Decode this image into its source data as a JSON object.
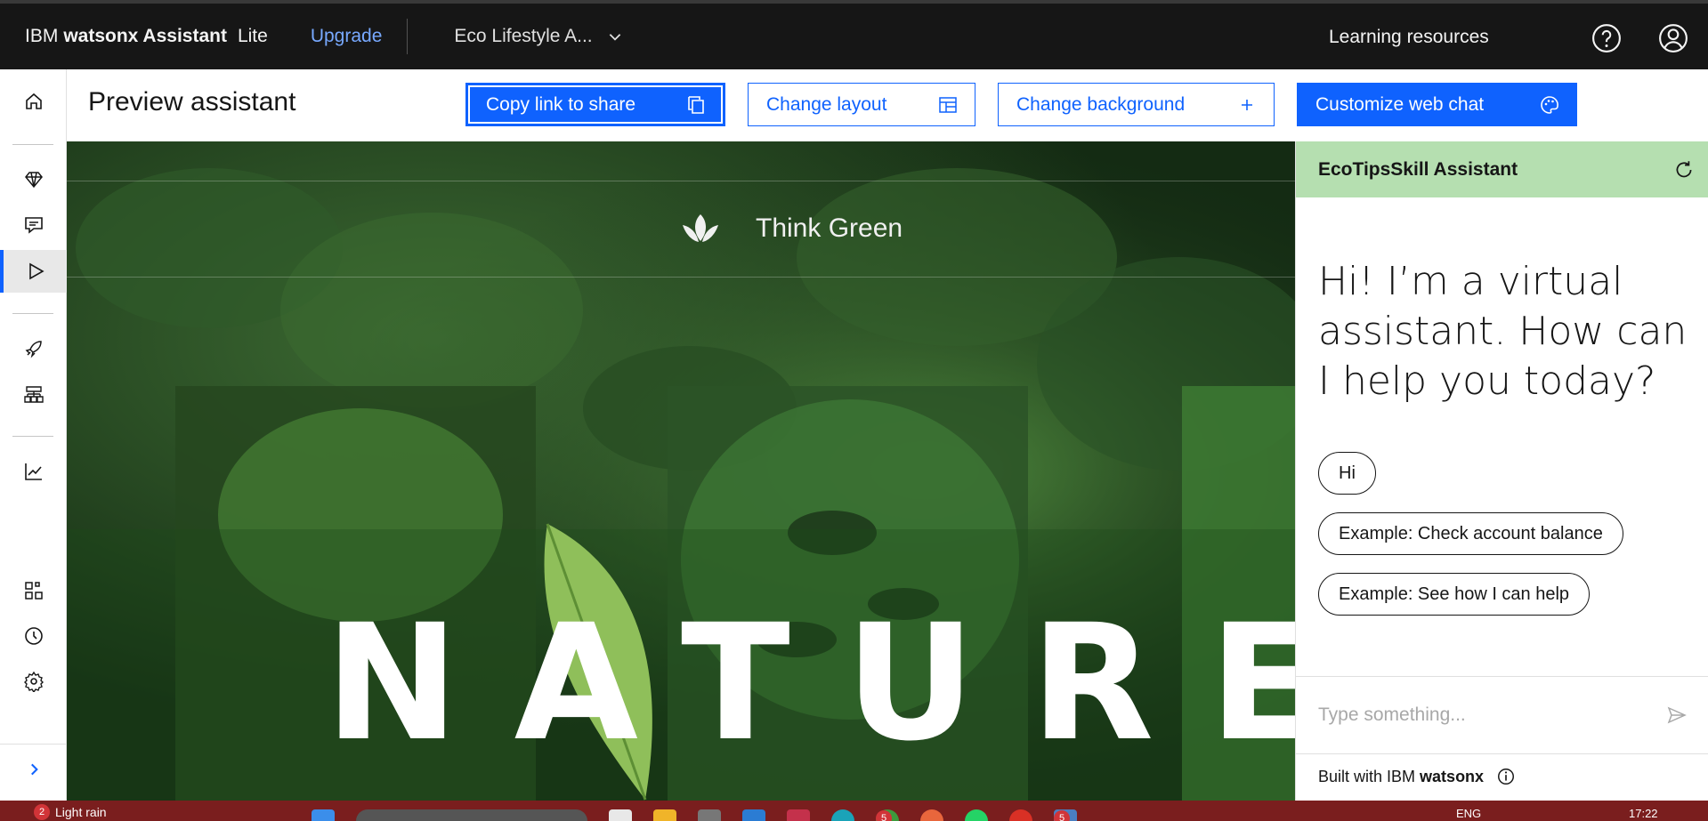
{
  "header": {
    "brand_ibm": "IBM",
    "brand_product": "watsonx Assistant",
    "brand_plan": "Lite",
    "upgrade_label": "Upgrade",
    "workspace_name": "Eco Lifestyle A...",
    "learning_label": "Learning resources"
  },
  "sidebar": {
    "items": [
      {
        "icon": "home-icon"
      },
      {
        "icon": "diamond-icon"
      },
      {
        "icon": "chat-icon"
      },
      {
        "icon": "play-icon",
        "active": true
      },
      {
        "icon": "rocket-icon"
      },
      {
        "icon": "flow-icon"
      },
      {
        "icon": "analytics-icon"
      },
      {
        "icon": "integrations-icon"
      },
      {
        "icon": "history-icon"
      },
      {
        "icon": "settings-icon"
      }
    ],
    "expand_icon": "chevron-right-icon"
  },
  "toolbar": {
    "title": "Preview assistant",
    "copy_link_label": "Copy link to share",
    "change_layout_label": "Change layout",
    "change_background_label": "Change background",
    "customize_label": "Customize web chat"
  },
  "preview": {
    "brand_text": "Think Green",
    "hero_text": "NATURE"
  },
  "chat": {
    "title": "EcoTipsSkill Assistant",
    "greeting": "Hi! I’m a virtual assistant. How can I help you today?",
    "options": [
      "Hi",
      "Example: Check account balance",
      "Example: See how I can help"
    ],
    "input_placeholder": "Type something...",
    "built_prefix": "Built with IBM",
    "built_brand": "watsonx",
    "header_color": "#b5dfb0"
  },
  "taskbar": {
    "notification_count": "2",
    "weather": "Light rain",
    "language": "ENG",
    "time": "17:22",
    "app_badge_a": "5",
    "app_badge_b": "5"
  },
  "colors": {
    "accent": "#0f62fe",
    "topbar": "#161616",
    "taskbar": "#7a1e1e"
  }
}
